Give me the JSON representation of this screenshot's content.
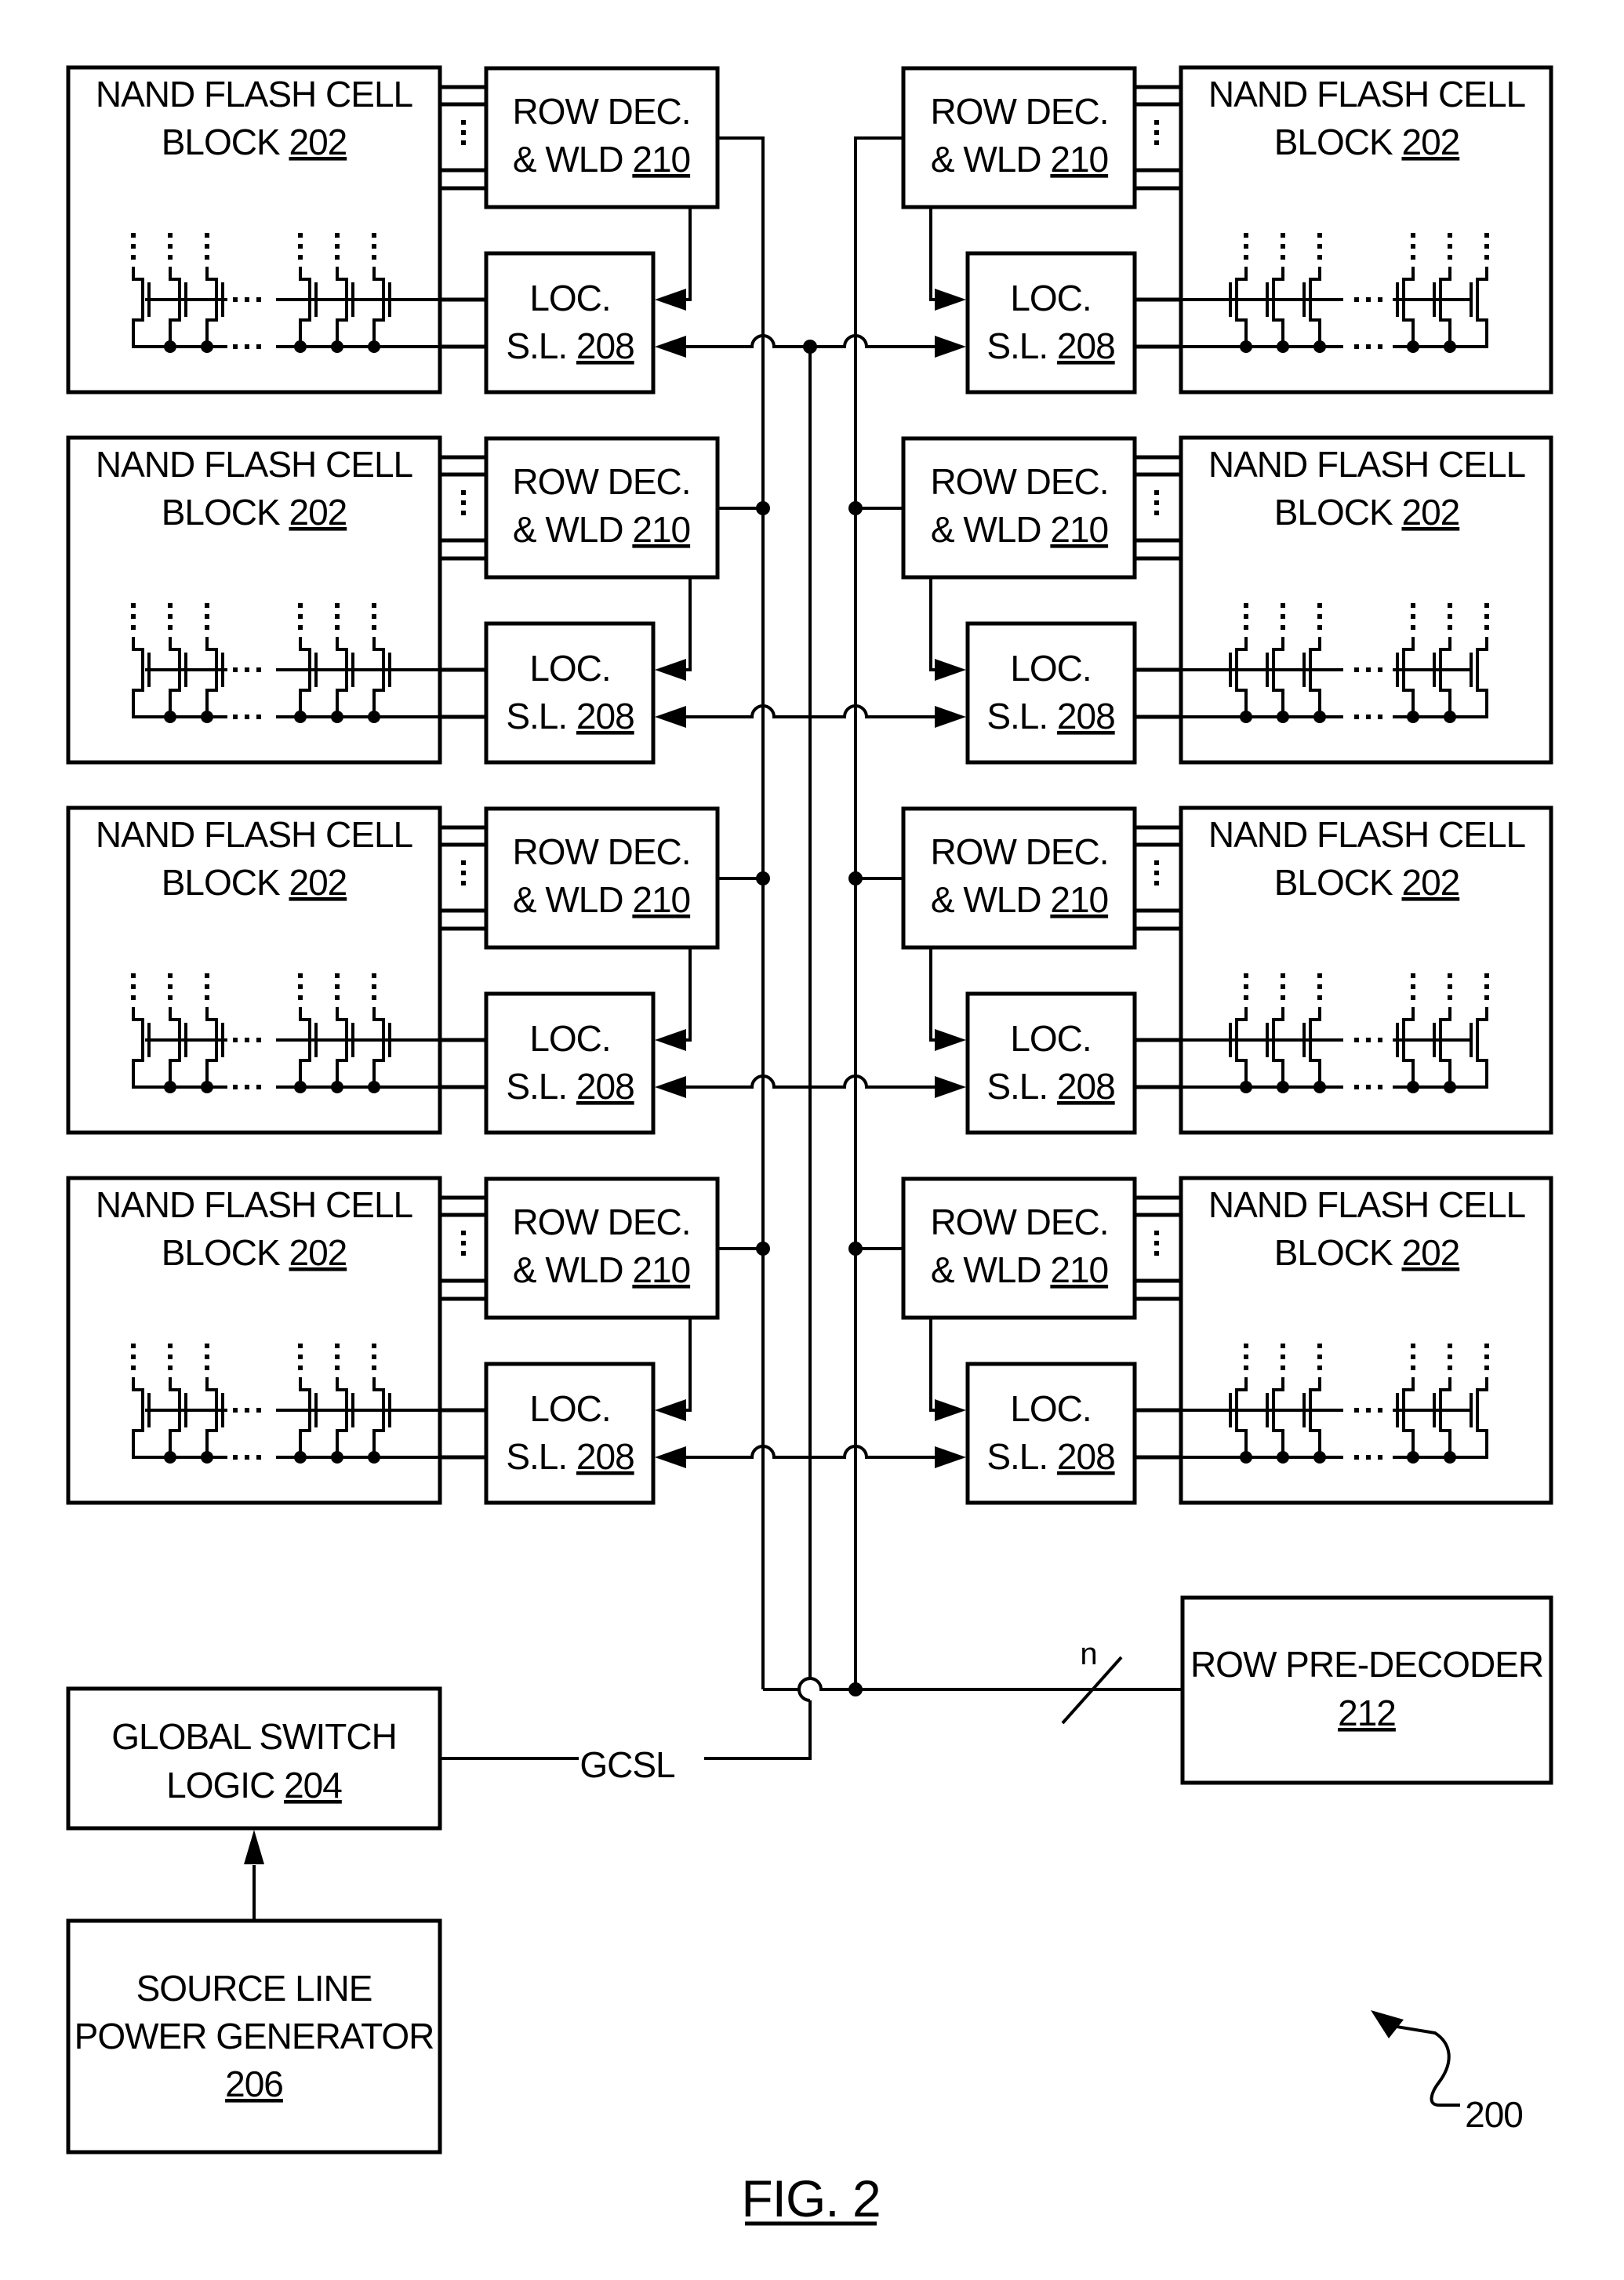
{
  "figure": {
    "title": "FIG. 2",
    "reference_numeral": "200"
  },
  "cell_block": {
    "line1": "NAND FLASH CELL",
    "line2_prefix": "BLOCK ",
    "ref": "202",
    "count_per_side": 4
  },
  "row_decoder": {
    "line1": "ROW DEC.",
    "line2_prefix": "& WLD ",
    "ref": "210"
  },
  "local_source_line": {
    "line1": "LOC.",
    "line2_prefix": "S.L. ",
    "ref": "208"
  },
  "global_switch_logic": {
    "line1": "GLOBAL SWITCH",
    "line2_prefix": "LOGIC ",
    "ref": "204"
  },
  "source_line_power_generator": {
    "line1": "SOURCE LINE",
    "line2": "POWER GENERATOR",
    "ref": "206"
  },
  "row_pre_decoder": {
    "line1": "ROW PRE-DECODER",
    "ref": "212"
  },
  "signals": {
    "gcsl": "GCSL",
    "bus_width": "n"
  },
  "colors": {
    "ink": "#000000",
    "paper": "#ffffff"
  }
}
